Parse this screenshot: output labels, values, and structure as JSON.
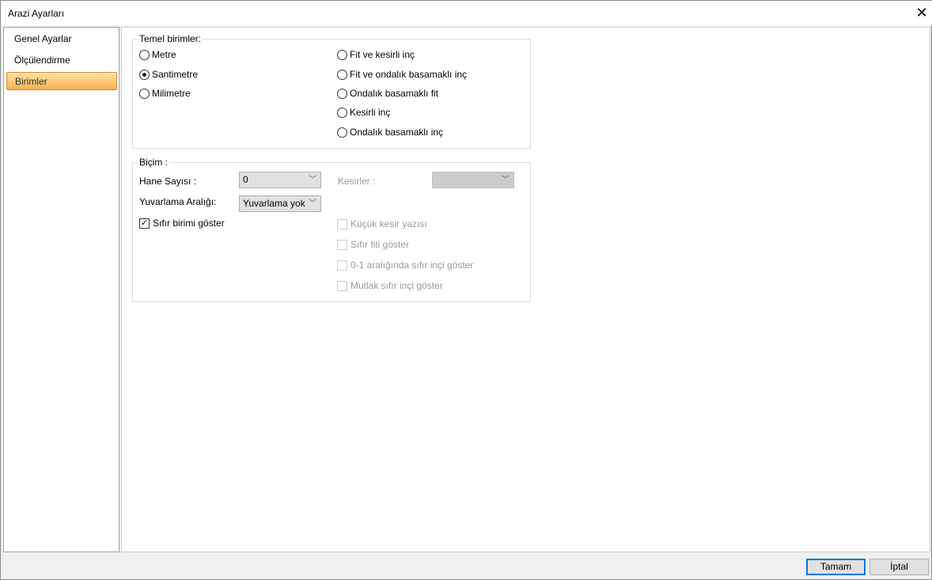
{
  "window": {
    "title": "Arazi Ayarları"
  },
  "nav": {
    "items": [
      {
        "label": "Genel Ayarlar",
        "selected": false
      },
      {
        "label": "Ölçülendirme",
        "selected": false
      },
      {
        "label": "Birimler",
        "selected": true
      }
    ]
  },
  "units": {
    "legend": "Temel birimler:",
    "options": [
      "Metre",
      "Santimetre",
      "Milimetre",
      "Fit ve kesirli inç",
      "Fit ve ondalık basamaklı inç",
      "Ondalık basamaklı fit",
      "Kesirli inç",
      "Ondalık basamaklı inç"
    ],
    "selected": "Santimetre"
  },
  "format": {
    "legend": "Biçim :",
    "digits_label": "Hane Sayısı :",
    "digits_value": "0",
    "fractions_label": "Kesirler :",
    "fractions_value": "",
    "rounding_label": "Yuvarlama Aralığı:",
    "rounding_value": "Yuvarlama yok",
    "checks": [
      {
        "label": "Sıfır birimi göster",
        "checked": true,
        "enabled": true
      },
      {
        "label": "Küçük kesir yazısı",
        "checked": false,
        "enabled": false
      },
      {
        "label": "Sıfır fiti göster",
        "checked": false,
        "enabled": false
      },
      {
        "label": "0-1 aralığında sıfır inçi göster",
        "checked": false,
        "enabled": false
      },
      {
        "label": "Mutlak sıfır inçi göster",
        "checked": false,
        "enabled": false
      }
    ]
  },
  "buttons": {
    "ok": "Tamam",
    "cancel": "İptal"
  }
}
